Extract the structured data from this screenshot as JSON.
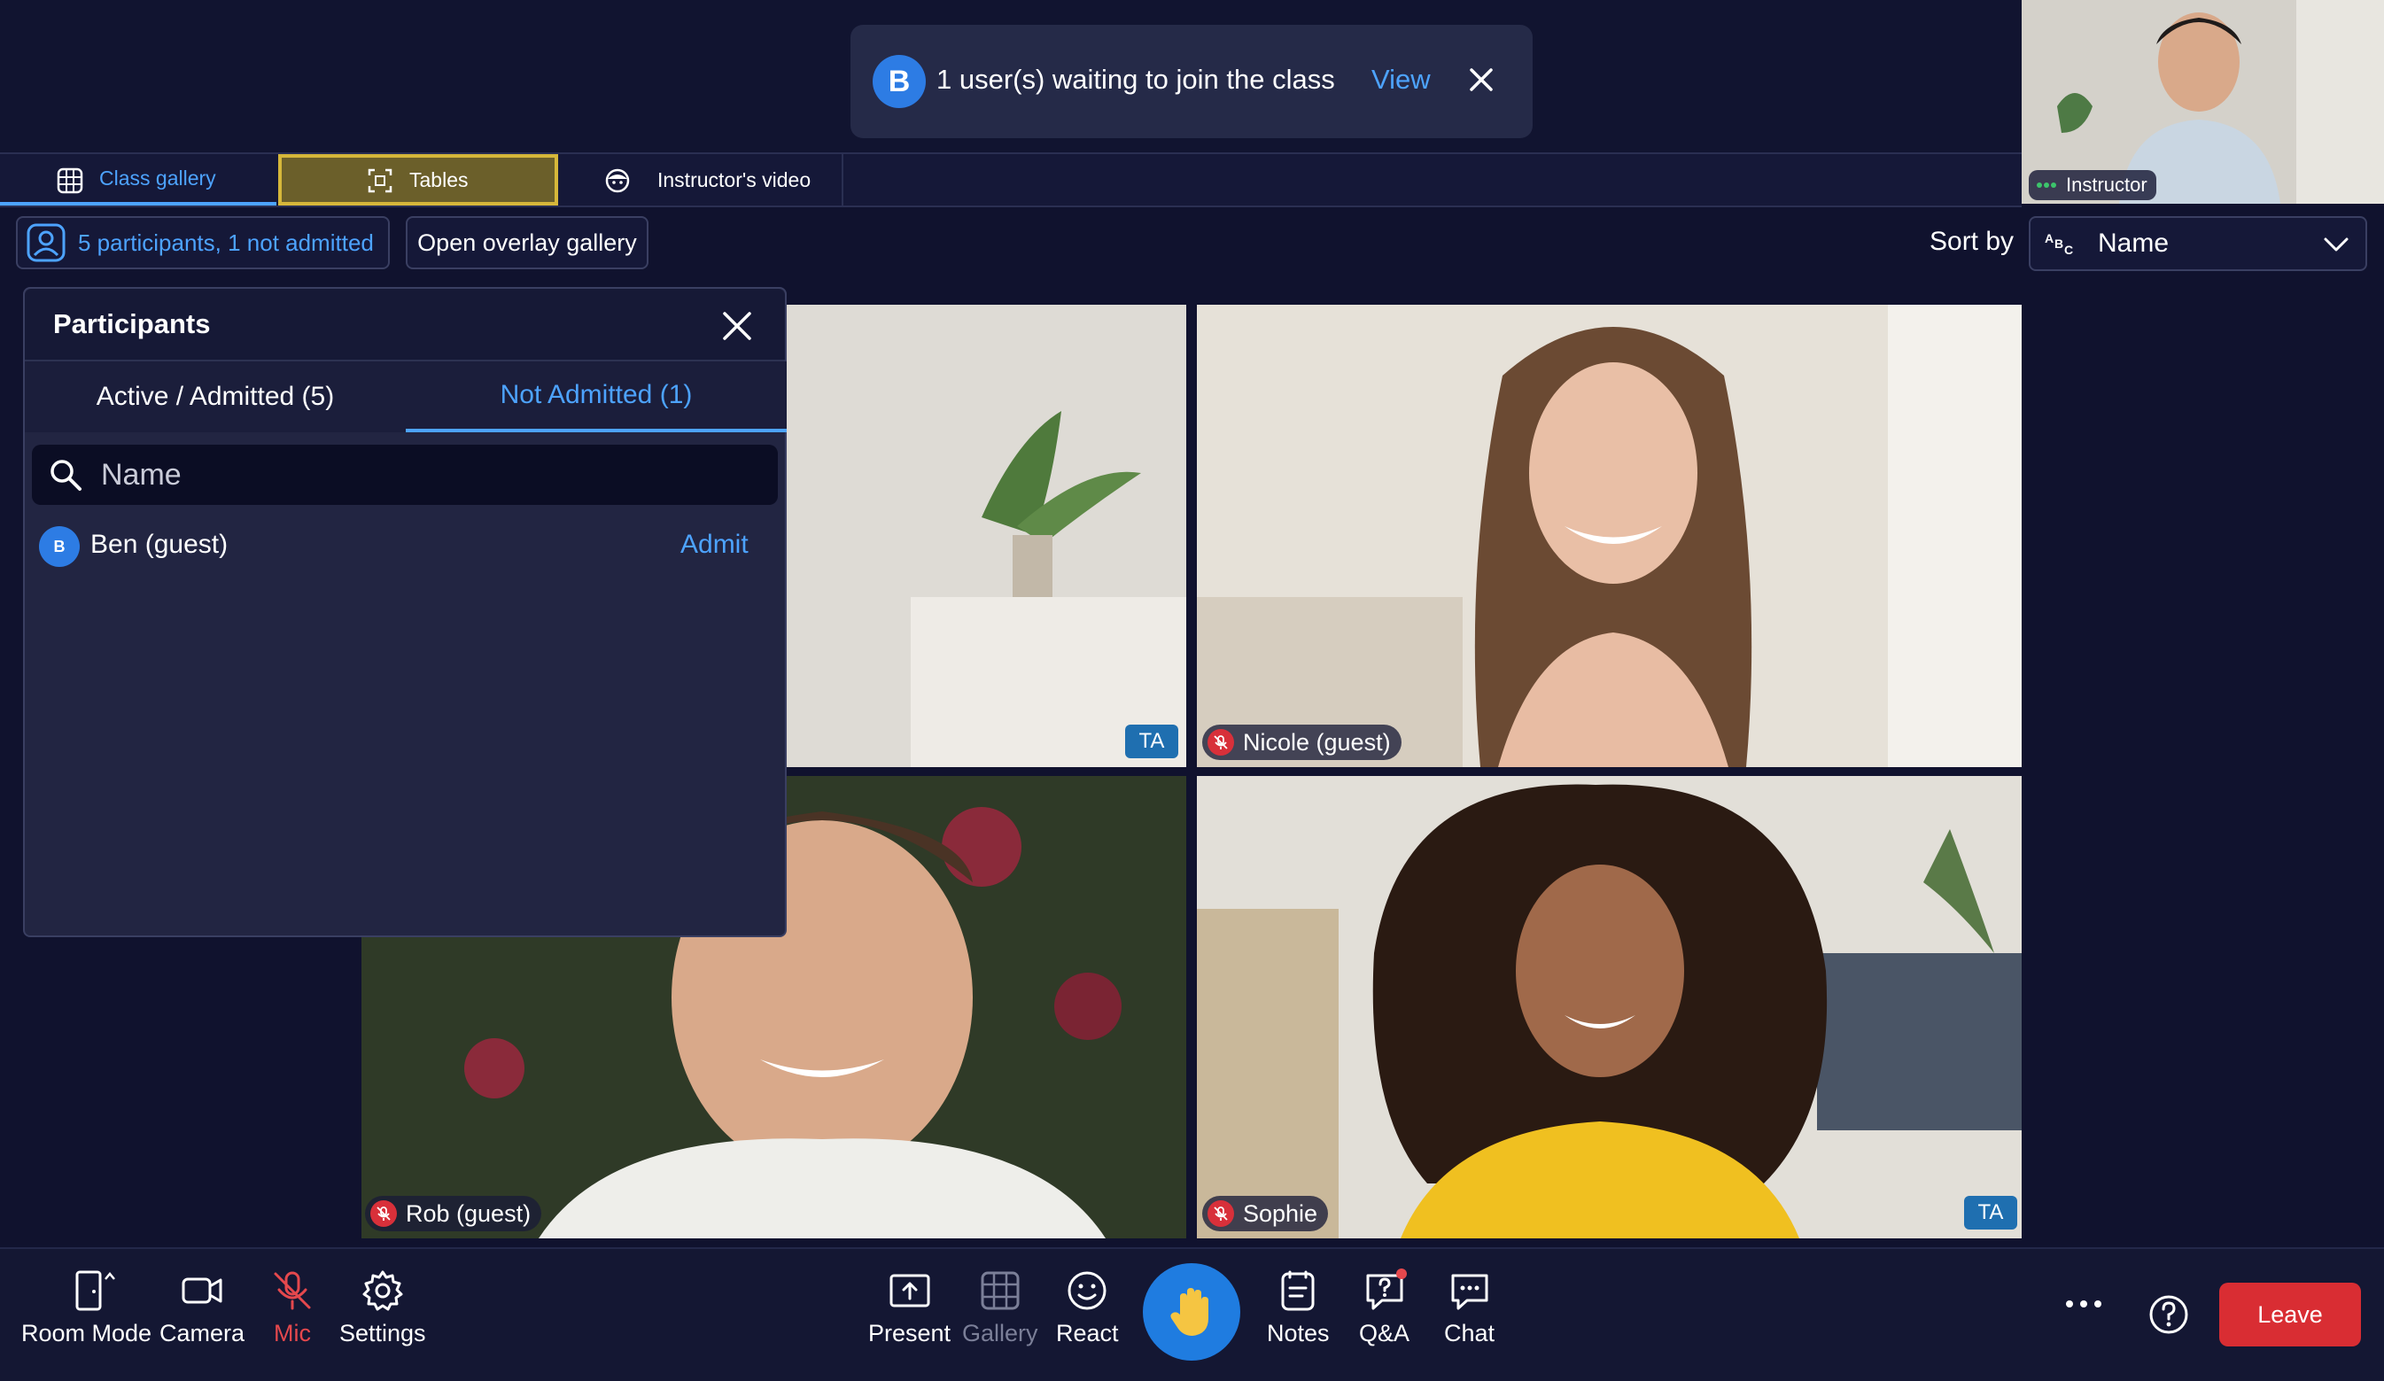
{
  "banner": {
    "avatar_initial": "B",
    "message": "1 user(s) waiting to join the class",
    "view_label": "View"
  },
  "tabs": [
    {
      "label": "Class gallery",
      "active": true
    },
    {
      "label": "Tables",
      "highlighted": true
    },
    {
      "label": "Instructor's video"
    }
  ],
  "pip": {
    "label": "Instructor"
  },
  "controls": {
    "participants_label": "5 participants, 1 not admitted",
    "overlay_label": "Open overlay gallery",
    "sort_by_label": "Sort by",
    "sort_value": "Name"
  },
  "tiles": [
    {
      "name": "",
      "badge": "TA",
      "muted": false
    },
    {
      "name": "Nicole (guest)",
      "badge": "",
      "muted": true
    },
    {
      "name": "Rob (guest)",
      "badge": "",
      "muted": true
    },
    {
      "name": "Sophie",
      "badge": "TA",
      "muted": true
    }
  ],
  "participants_panel": {
    "title": "Participants",
    "tabs": [
      {
        "label": "Active / Admitted (5)"
      },
      {
        "label": "Not Admitted (1)",
        "active": true
      }
    ],
    "search_placeholder": "Name",
    "rows": [
      {
        "initial": "B",
        "name": "Ben (guest)",
        "action": "Admit"
      }
    ]
  },
  "toolbar": {
    "room_mode": "Room Mode",
    "camera": "Camera",
    "mic": "Mic",
    "settings": "Settings",
    "present": "Present",
    "gallery": "Gallery",
    "react": "React",
    "notes": "Notes",
    "qa": "Q&A",
    "chat": "Chat",
    "leave": "Leave"
  },
  "colors": {
    "accent": "#4da3ff",
    "background": "#10122e",
    "leave": "#d92d33",
    "mic_muted": "#e5484d",
    "raise_hand": "#1f7ce0"
  }
}
